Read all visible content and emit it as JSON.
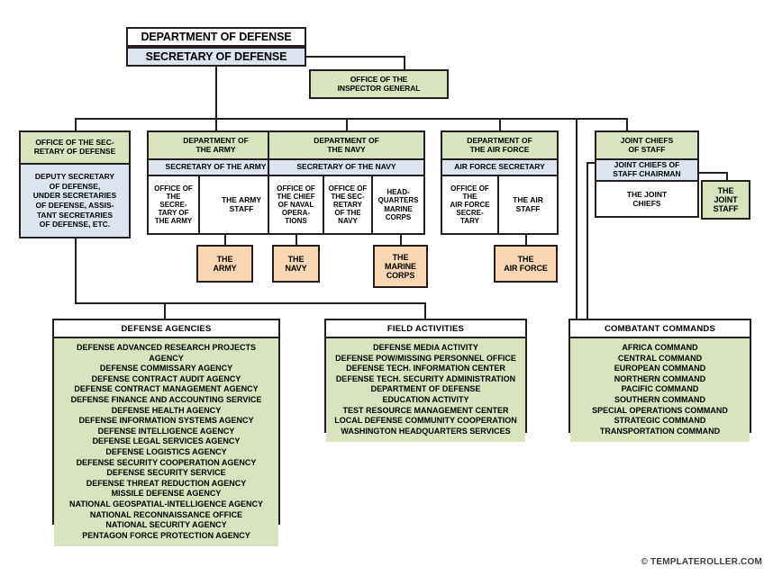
{
  "top": {
    "department": "DEPARTMENT OF DEFENSE",
    "secretary": "SECRETARY OF DEFENSE",
    "inspector_general": "OFFICE OF THE\nINSPECTOR GENERAL"
  },
  "osd": {
    "header": "OFFICE OF THE SEC-\nRETARY OF DEFENSE",
    "body": "DEPUTY SECRETARY\nOF DEFENSE,\nUNDER SECRETARIES\nOF DEFENSE, ASSIS-\nTANT SECRETARIES\nOF DEFENSE, ETC."
  },
  "army": {
    "header": "DEPARTMENT OF\nTHE ARMY",
    "secretary": "SECRETARY OF THE ARMY",
    "col1": "OFFICE OF\nTHE\nSECRE-\nTARY OF\nTHE ARMY",
    "col2": "THE ARMY\nSTAFF",
    "service": "THE\nARMY"
  },
  "navy": {
    "header": "DEPARTMENT OF\nTHE NAVY",
    "secretary": "SECRETARY OF THE NAVY",
    "col1": "OFFICE OF\nTHE CHIEF\nOF NAVAL\nOPERA-\nTIONS",
    "col2": "OFFICE OF\nTHE SEC-\nRETARY\nOF THE\nNAVY",
    "col3": "HEAD-\nQUARTERS\nMARINE\nCORPS",
    "service1": "THE\nNAVY",
    "service2": "THE\nMARINE\nCORPS"
  },
  "airforce": {
    "header": "DEPARTMENT OF\nTHE AIR FORCE",
    "secretary": "AIR FORCE SECRETARY",
    "col1": "OFFICE OF\nTHE\nAIR FORCE\nSECRE-\nTARY",
    "col2": "THE AIR\nSTAFF",
    "service": "THE\nAIR FORCE"
  },
  "joint": {
    "header": "JOINT CHIEFS\nOF STAFF",
    "chairman": "JOINT CHIEFS OF\nSTAFF CHAIRMAN",
    "chiefs": "THE JOINT\nCHIEFS",
    "staff": "THE\nJOINT\nSTAFF"
  },
  "defense_agencies": {
    "title": "DEFENSE AGENCIES",
    "items": [
      "DEFENSE ADVANCED RESEARCH PROJECTS AGENCY",
      "DEFENSE COMMISSARY AGENCY",
      "DEFENSE CONTRACT AUDIT AGENCY",
      "DEFENSE CONTRACT MANAGEMENT AGENCY",
      "DEFENSE FINANCE AND ACCOUNTING SERVICE",
      "DEFENSE HEALTH AGENCY",
      "DEFENSE INFORMATION SYSTEMS AGENCY",
      "DEFENSE INTELLIGENCE AGENCY",
      "DEFENSE LEGAL SERVICES AGENCY",
      "DEFENSE LOGISTICS AGENCY",
      "DEFENSE SECURITY COOPERATION AGENCY",
      "DEFENSE SECURITY SERVICE",
      "DEFENSE THREAT REDUCTION AGENCY",
      "MISSILE DEFENSE AGENCY",
      "NATIONAL GEOSPATIAL-INTELLIGENCE AGENCY",
      "NATIONAL RECONNAISSANCE OFFICE",
      "NATIONAL SECURITY AGENCY",
      "PENTAGON FORCE PROTECTION AGENCY"
    ]
  },
  "field_activities": {
    "title": "FIELD ACTIVITIES",
    "items": [
      "DEFENSE MEDIA ACTIVITY",
      "DEFENSE POW/MISSING PERSONNEL OFFICE",
      "DEFENSE TECH. INFORMATION CENTER",
      "DEFENSE TECH. SECURITY ADMINISTRATION",
      "DEPARTMENT OF DEFENSE",
      "EDUCATION ACTIVITY",
      "TEST RESOURCE MANAGEMENT CENTER",
      "LOCAL DEFENSE COMMUNITY COOPERATION",
      "WASHINGTON HEADQUARTERS SERVICES"
    ]
  },
  "combatant_commands": {
    "title": "COMBATANT COMMANDS",
    "items": [
      "AFRICA COMMAND",
      "CENTRAL COMMAND",
      "EUROPEAN COMMAND",
      "NORTHERN COMMAND",
      "PACIFIC COMMAND",
      "SOUTHERN COMMAND",
      "SPECIAL OPERATIONS COMMAND",
      "STRATEGIC COMMAND",
      "TRANSPORTATION COMMAND"
    ]
  },
  "footer": "© TEMPLATEROLLER.COM",
  "colors": {
    "green": "#d7e4bd",
    "blue": "#dce4f0",
    "orange": "#fad6b2",
    "line": "#231f20"
  }
}
